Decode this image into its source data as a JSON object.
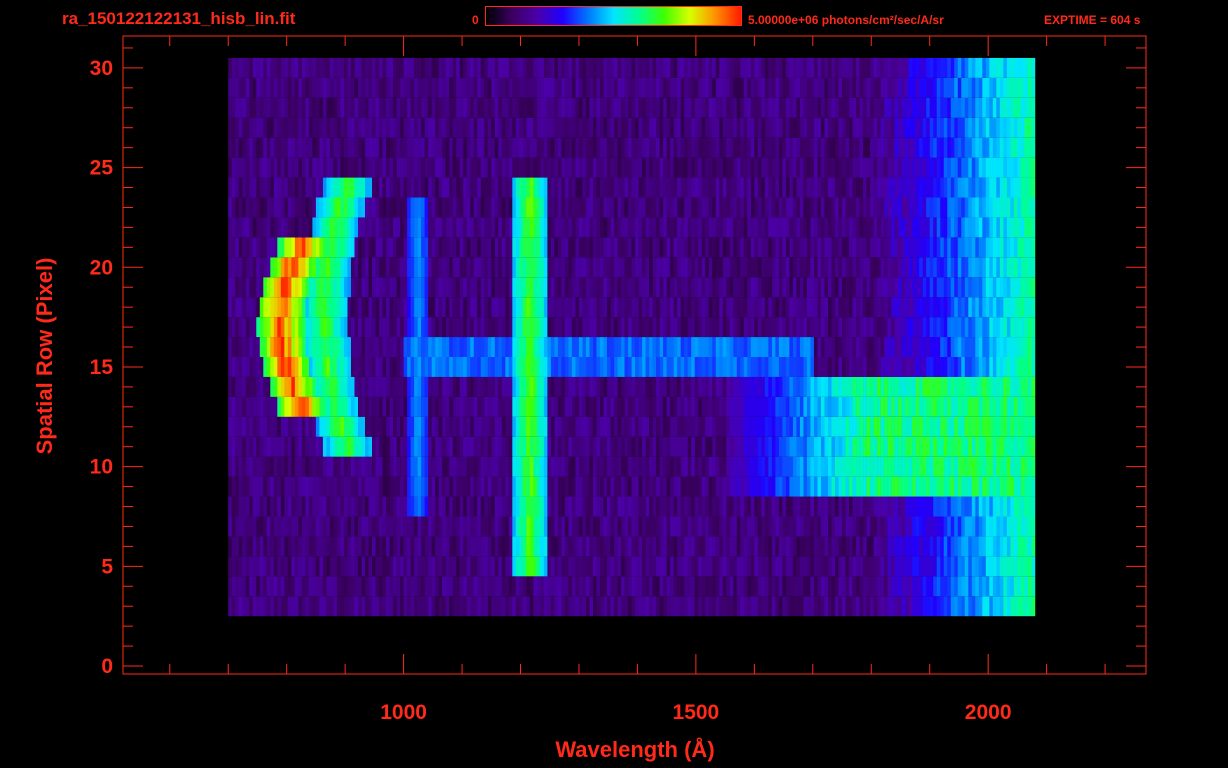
{
  "header": {
    "filename": "ra_150122122131_hisb_lin.fit",
    "colorbar_min": "0",
    "colorbar_max": "5.00000e+06 photons/cm²/sec/A/sr",
    "exptime": "EXPTIME = 604 s"
  },
  "colors": {
    "axis": "#ff2a1a",
    "background": "#000000",
    "colormap": [
      "#000000",
      "#3a0060",
      "#4b00a8",
      "#2000ff",
      "#0077ff",
      "#00e5ff",
      "#00ff90",
      "#40ff00",
      "#d8ff00",
      "#ff9000",
      "#ff1a00"
    ]
  },
  "chart_data": {
    "type": "heatmap",
    "title": "",
    "xlabel": "Wavelength (Å)",
    "ylabel": "Spatial Row (Pixel)",
    "xlim": [
      520,
      2270
    ],
    "ylim": [
      -0.4,
      31.6
    ],
    "x_ticks": [
      1000,
      1500,
      2000
    ],
    "y_ticks": [
      0,
      5,
      10,
      15,
      20,
      25,
      30
    ],
    "grid": false,
    "data_extent": {
      "x": [
        700,
        2080
      ],
      "rows": [
        3,
        30
      ]
    },
    "features": [
      {
        "label": "",
        "type": "curved emission band",
        "x_center": 790,
        "x_width": 40,
        "rows": [
          13,
          21
        ],
        "level": 1.0
      },
      {
        "label": "",
        "type": "curved emission band",
        "x_center": 865,
        "x_width": 40,
        "rows": [
          11,
          24
        ],
        "level": 0.7
      },
      {
        "label": "",
        "type": "emission line",
        "x_center": 1025,
        "x_width": 20,
        "rows": [
          8,
          23
        ],
        "level": 0.45
      },
      {
        "label": "",
        "type": "emission line",
        "x_center": 1216,
        "x_width": 30,
        "rows": [
          5,
          24
        ],
        "level": 0.72
      },
      {
        "label": "",
        "type": "continuum",
        "x_start": 1000,
        "x_end": 1700,
        "rows": [
          15,
          16
        ],
        "level": 0.4
      },
      {
        "label": "",
        "type": "continuum",
        "x_start": 1550,
        "x_end": 2080,
        "rows": [
          9,
          14
        ],
        "level": 0.62
      }
    ]
  }
}
